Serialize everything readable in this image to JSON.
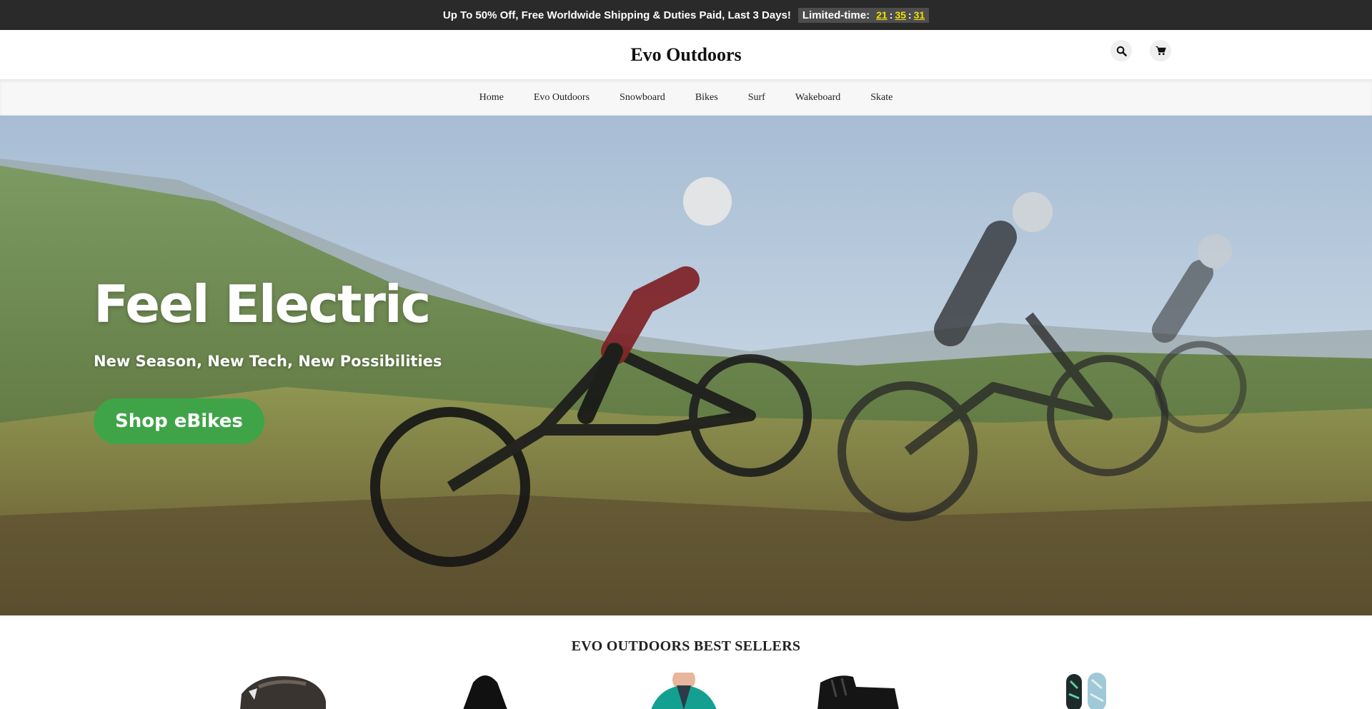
{
  "announcement": {
    "message": "Up To 50% Off, Free Worldwide Shipping & Duties Paid, Last 3 Days!",
    "timer_label": "Limited-time:",
    "hours": "21",
    "minutes": "35",
    "seconds": "31",
    "separator": ":"
  },
  "header": {
    "logo": "Evo Outdoors",
    "icons": [
      "search-icon",
      "cart-icon"
    ]
  },
  "nav": {
    "items": [
      "Home",
      "Evo Outdoors",
      "Snowboard",
      "Bikes",
      "Surf",
      "Wakeboard",
      "Skate"
    ]
  },
  "hero": {
    "title": "Feel Electric",
    "subtitle": "New Season, New Tech, New Possibilities",
    "button": "Shop eBikes",
    "accent_color": "#3fa447"
  },
  "best_sellers": {
    "title": "EVO OUTDOORS BEST SELLERS",
    "products": [
      "snowboard-bindings-image",
      "black-hoodie-image",
      "ski-jacket-image",
      "snowboard-boots-image",
      "snowboard-image"
    ]
  }
}
